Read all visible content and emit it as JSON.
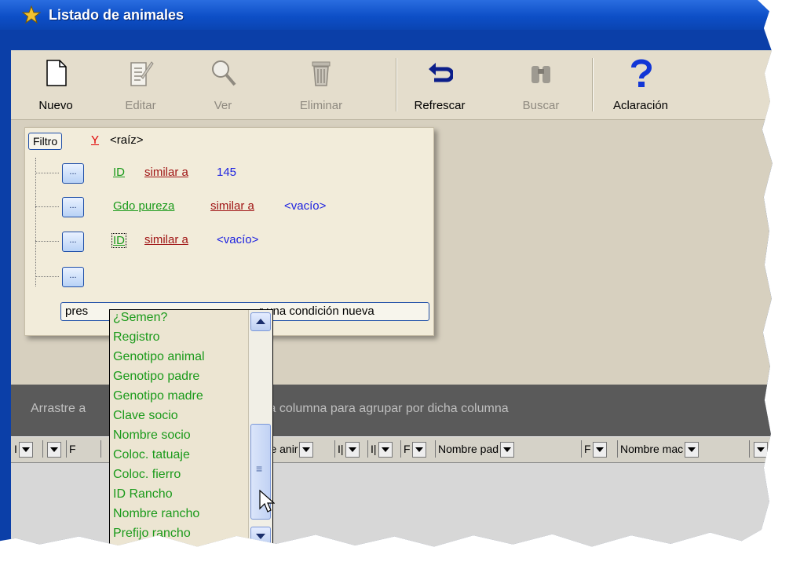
{
  "window": {
    "title": "Listado de animales"
  },
  "toolbar": {
    "buttons": [
      {
        "label": "Nuevo",
        "icon": "new-document-icon",
        "enabled": true
      },
      {
        "label": "Editar",
        "icon": "edit-document-icon",
        "enabled": false
      },
      {
        "label": "Ver",
        "icon": "magnifier-icon",
        "enabled": false
      },
      {
        "label": "Eliminar",
        "icon": "trash-can-icon",
        "enabled": false
      },
      {
        "label": "Refrescar",
        "icon": "refresh-icon",
        "enabled": true
      },
      {
        "label": "Buscar",
        "icon": "binoculars-icon",
        "enabled": false
      },
      {
        "label": "Aclaración",
        "icon": "question-mark-icon",
        "enabled": true
      }
    ]
  },
  "filter": {
    "button_label": "Filtro",
    "logic_operator": "Y",
    "root_label": "<raíz>",
    "conditions": [
      {
        "field": "ID",
        "operator": "similar a",
        "value": "145"
      },
      {
        "field": "Gdo pureza",
        "operator": "similar a",
        "value": "<vacío>"
      },
      {
        "field": "ID",
        "operator": "similar a",
        "value": "<vacío>"
      }
    ],
    "add_button_left": "pres",
    "add_button_right": "r una condición nueva"
  },
  "field_dropdown": {
    "items": [
      "¿Semen?",
      "Registro",
      "Genotipo animal",
      "Genotipo padre",
      "Genotipo madre",
      "Clave socio",
      "Nombre socio",
      "Coloc. tatuaje",
      "Coloc. fierro",
      "ID Rancho",
      "Nombre rancho",
      "Prefijo rancho"
    ]
  },
  "grid": {
    "group_hint_left": "Arrastre a",
    "group_hint_right": "la columna para agrupar por dicha columna",
    "columns": [
      "I",
      "",
      "F",
      "bre anir",
      "I|",
      "I|",
      "F",
      "Nombre pad",
      "F",
      "Nombre mac",
      ""
    ]
  },
  "colors": {
    "titlebar": "#0d4fc7",
    "field_text": "#1a9a1a",
    "operator_text": "#a01515",
    "value_text": "#1e23e0",
    "logic_operator": "#e00000"
  }
}
